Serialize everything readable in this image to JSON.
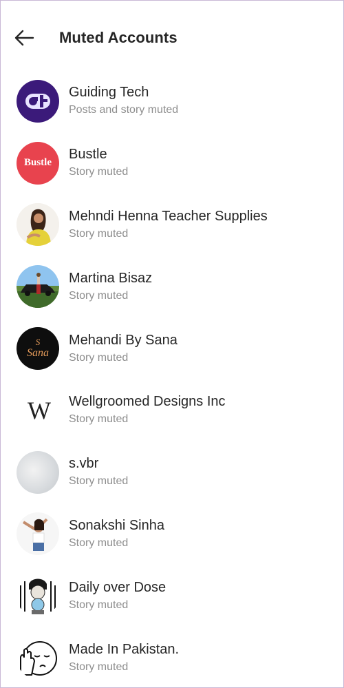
{
  "header": {
    "back_icon": "arrow-left-icon",
    "title": "Muted Accounts"
  },
  "accounts": [
    {
      "name": "Guiding Tech",
      "status": "Posts and story muted",
      "avatar_text": "Gt",
      "color": "#3b1a7a"
    },
    {
      "name": "Bustle",
      "status": "Story muted",
      "avatar_text": "Bustle",
      "color": "#e8434e"
    },
    {
      "name": "Mehndi Henna Teacher Supplies",
      "status": "Story muted"
    },
    {
      "name": "Martina Bisaz",
      "status": "Story muted"
    },
    {
      "name": "Mehandi By Sana",
      "status": "Story muted",
      "avatar_text": "Sana"
    },
    {
      "name": "Wellgroomed Designs Inc",
      "status": "Story muted",
      "avatar_text": "W"
    },
    {
      "name": "s.vbr",
      "status": "Story muted"
    },
    {
      "name": "Sonakshi Sinha",
      "status": "Story muted"
    },
    {
      "name": "Daily over Dose",
      "status": "Story muted"
    },
    {
      "name": "Made In Pakistan.",
      "status": "Story muted"
    }
  ]
}
